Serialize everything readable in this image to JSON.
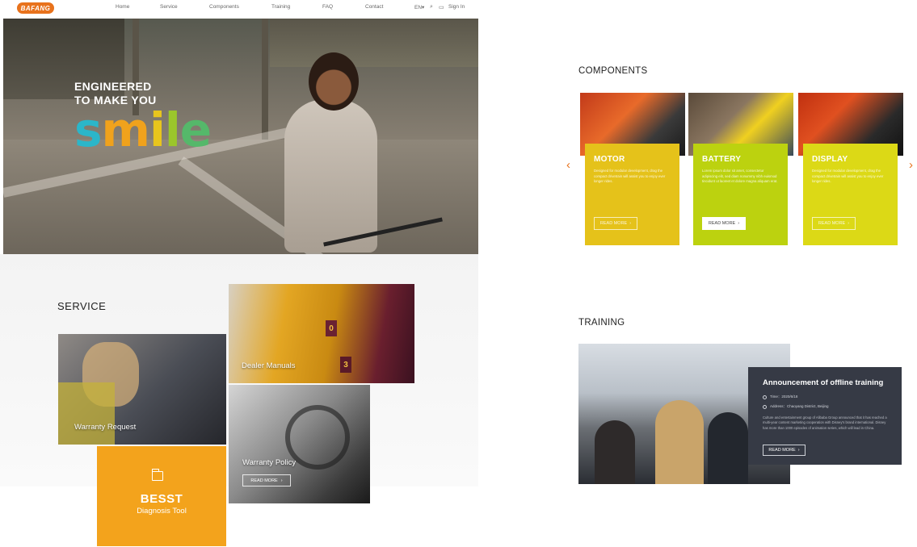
{
  "nav": {
    "logo": "BAFANG",
    "items": [
      "Home",
      "Service",
      "Components",
      "Training",
      "FAQ",
      "Contact"
    ],
    "language": "EN▾",
    "search_icon": "search-icon",
    "chat_icon": "chat-icon",
    "sign_in": "Sign In"
  },
  "hero": {
    "line1": "ENGINEERED",
    "line2": "TO MAKE YOU",
    "smile": [
      "s",
      "m",
      "i",
      "l",
      "e"
    ],
    "smile_colors": [
      "#2bb6c9",
      "#f0a21c",
      "#e8c51d",
      "#9bc62b",
      "#55b86a"
    ]
  },
  "service": {
    "title": "SERVICE",
    "warranty_request": "Warranty Request",
    "dealer_manuals": "Dealer Manuals",
    "warranty_policy": "Warranty Policy",
    "read_more": "READ MORE",
    "besst_title": "BESST",
    "besst_subtitle": "Diagnosis Tool"
  },
  "components": {
    "title": "COMPONENTS",
    "prev_icon": "chevron-left-icon",
    "next_icon": "chevron-right-icon",
    "cards": [
      {
        "title": "MOTOR",
        "desc": "Designed for modular development, drag the compact drivetrain will assist you to enjoy ever longer rides.",
        "read_more": "READ MORE",
        "color": "#e5c21a"
      },
      {
        "title": "BATTERY",
        "desc": "Lorem ipsum dolor sit amet, consectetur adipiscing elit, sed diam nonummy nibh euismod tincidunt ut laoreet et dolore magna aliquam erat.",
        "read_more": "READ MORE",
        "color": "#bcd20f"
      },
      {
        "title": "DISPLAY",
        "desc": "Designed for modular development, drag the compact drivetrain will assist you to enjoy ever longer rides.",
        "read_more": "READ MORE",
        "color": "#dcd916"
      }
    ]
  },
  "training": {
    "title": "TRAINING",
    "card_title": "Announcement of offline training",
    "time": "Time：2020/6/18",
    "address": "Address：Chaoyang District, Beijing",
    "description": "Culture and entertainment group of Alibaba Group announced that it has reached a multi-year content marketing cooperation with Disney's brand international. Disney has more than 1000 episodes of animation series, which will lead in China.",
    "read_more": "READ MORE"
  }
}
